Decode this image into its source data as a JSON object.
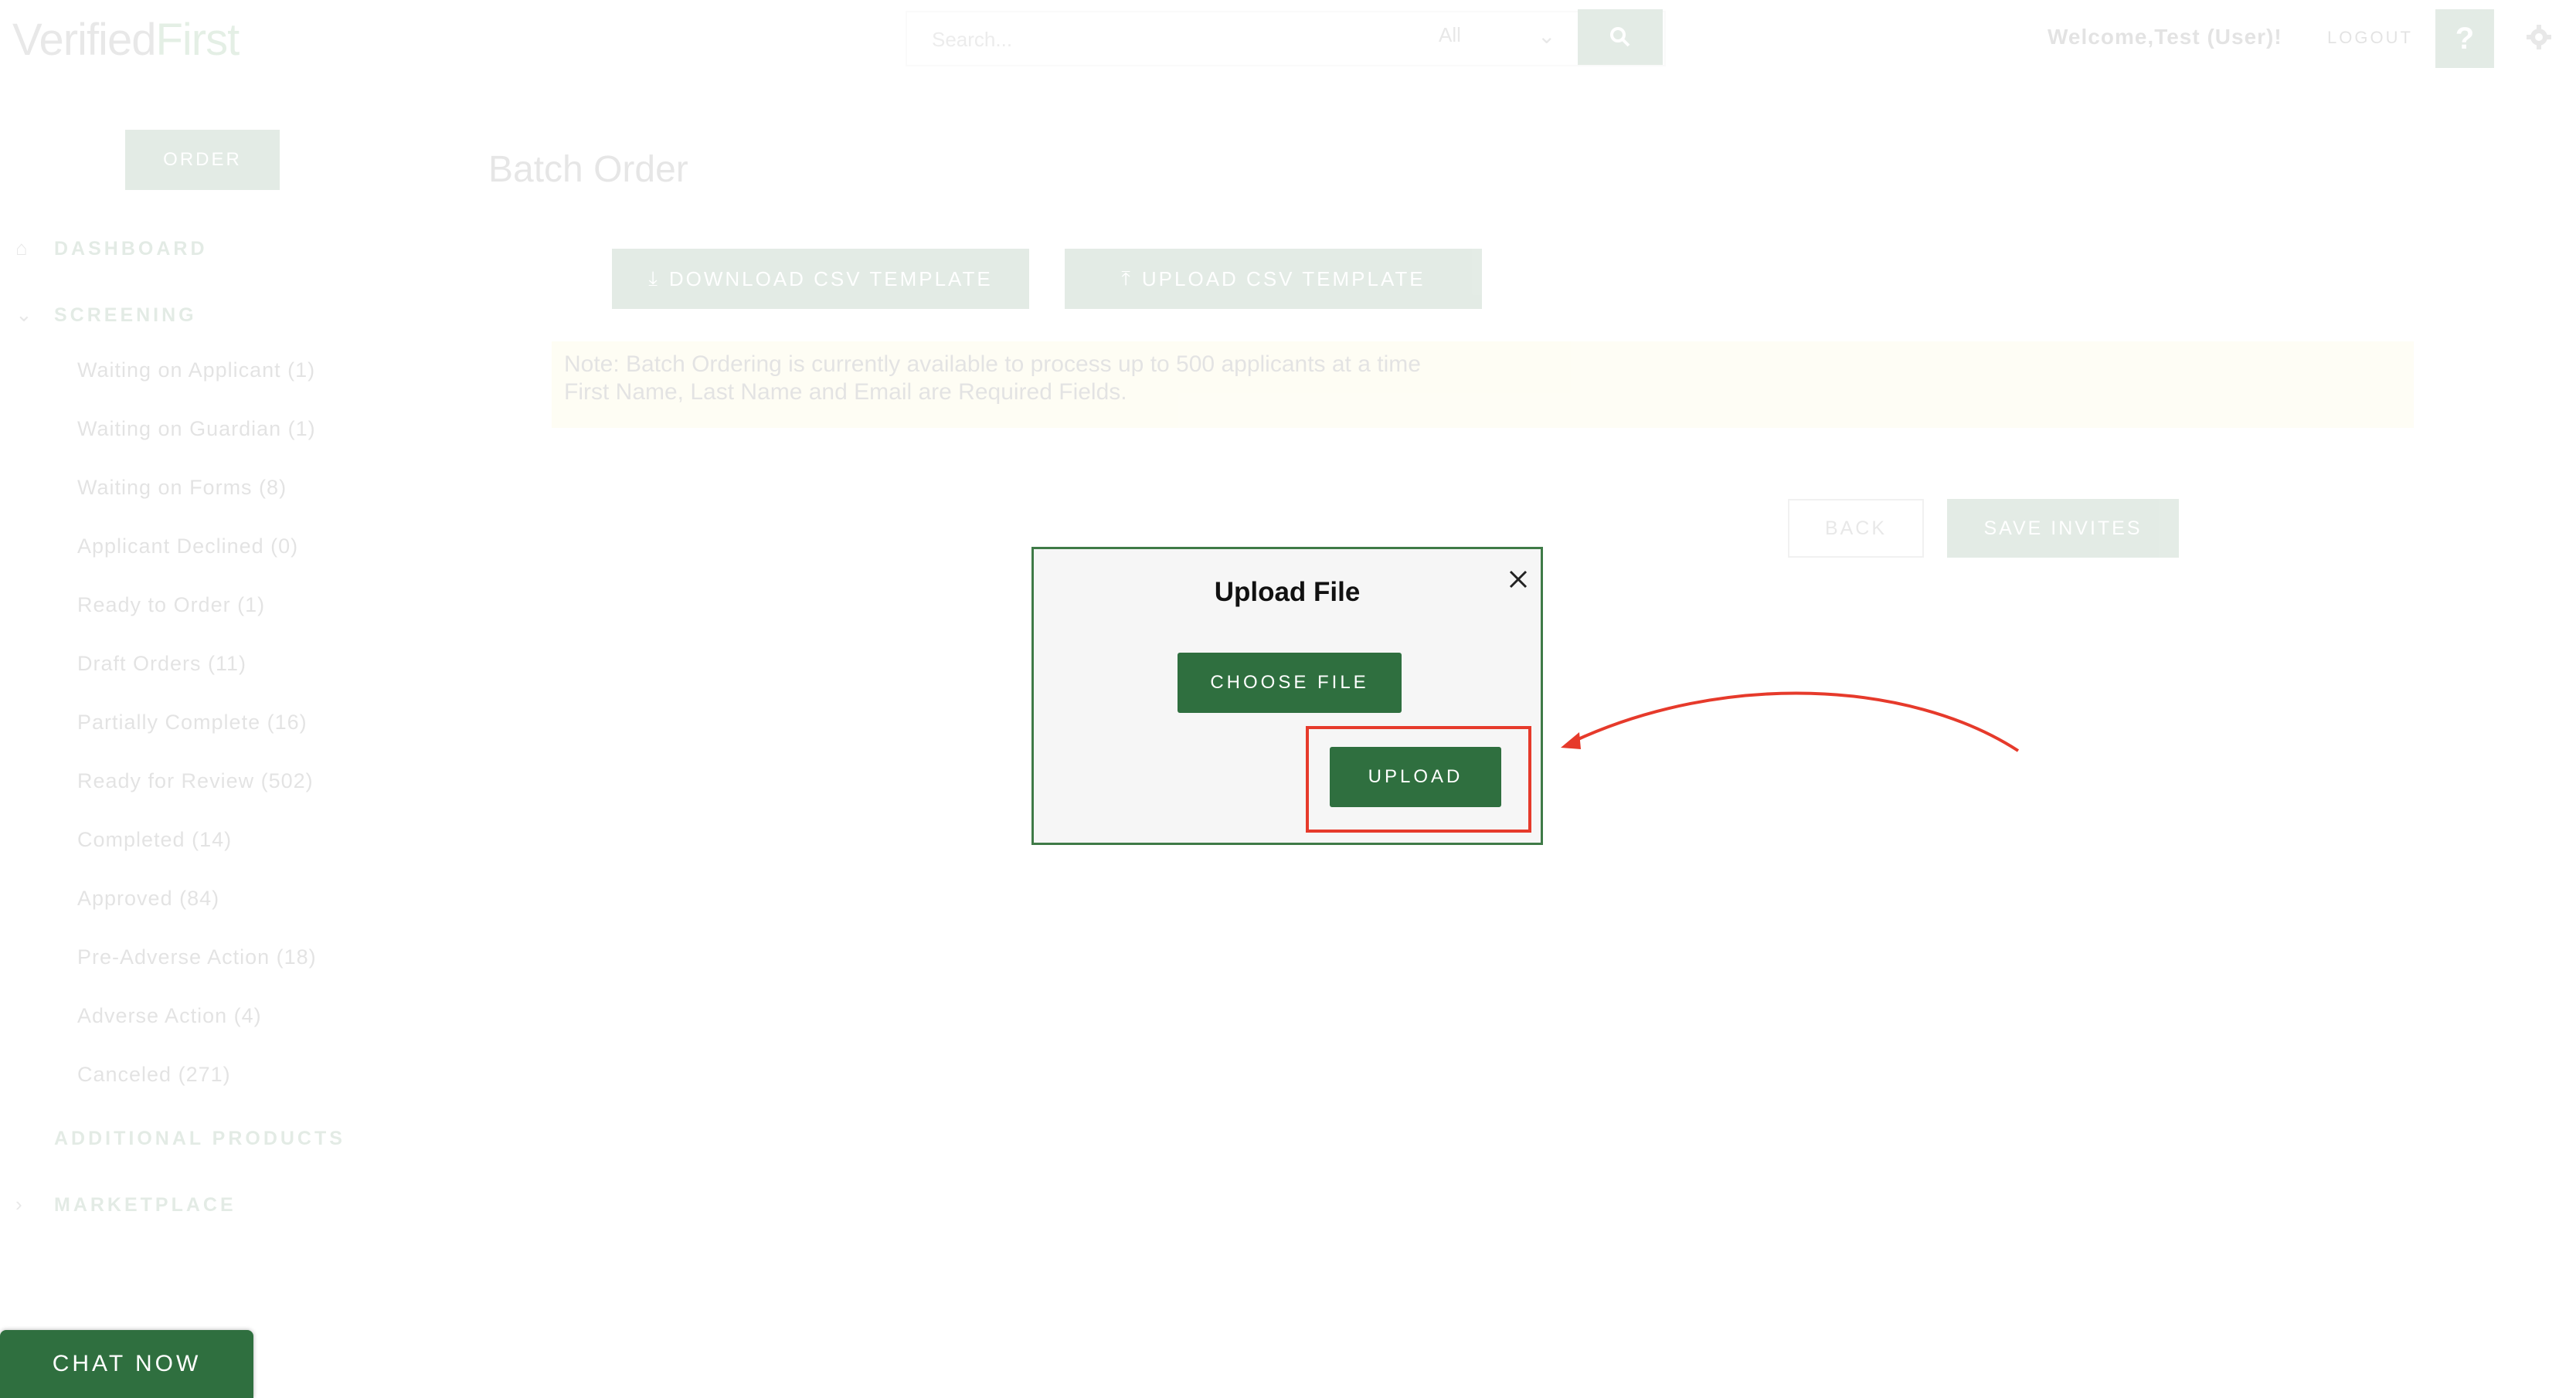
{
  "header": {
    "logo_part1": "Verified",
    "logo_part2": "First",
    "search_placeholder": "Search...",
    "search_filter": "All",
    "welcome": "Welcome,Test (User)!",
    "logout": "LOGOUT",
    "help": "?"
  },
  "sidebar": {
    "order_label": "ORDER",
    "dashboard_label": "DASHBOARD",
    "screening_label": "SCREENING",
    "items": [
      {
        "label": "Waiting on Applicant (1)"
      },
      {
        "label": "Waiting on Guardian (1)"
      },
      {
        "label": "Waiting on Forms (8)"
      },
      {
        "label": "Applicant Declined (0)"
      },
      {
        "label": "Ready to Order (1)"
      },
      {
        "label": "Draft Orders (11)"
      },
      {
        "label": "Partially Complete (16)"
      },
      {
        "label": "Ready for Review (502)"
      },
      {
        "label": "Completed (14)"
      },
      {
        "label": "Approved (84)"
      },
      {
        "label": "Pre-Adverse Action (18)"
      },
      {
        "label": "Adverse Action (4)"
      },
      {
        "label": "Canceled (271)"
      }
    ],
    "additional_products_label": "ADDITIONAL PRODUCTS",
    "marketplace_label": "MARKETPLACE"
  },
  "main": {
    "title": "Batch Order",
    "download_label": "DOWNLOAD CSV TEMPLATE",
    "upload_template_label": "UPLOAD CSV TEMPLATE",
    "note_line1": "Note: Batch Ordering is currently available to process up to 500 applicants at a time",
    "note_line2": "First Name, Last Name and Email are Required Fields.",
    "back_label": "BACK",
    "save_label": "SAVE INVITES"
  },
  "modal": {
    "title": "Upload File",
    "choose_label": "CHOOSE FILE",
    "upload_label": "UPLOAD"
  },
  "chat": {
    "label": "CHAT NOW"
  },
  "colors": {
    "brand_green": "#2f6f3f",
    "annotation_red": "#e63a2b"
  }
}
